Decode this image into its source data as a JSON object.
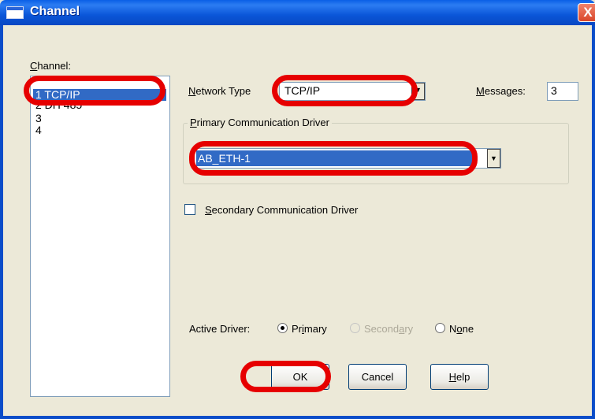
{
  "window": {
    "title": "Channel",
    "close_label": "X"
  },
  "channel_list": {
    "label_prefix": "C",
    "label_rest": "hannel:",
    "items": [
      {
        "label": "1  TCP/IP",
        "selected": true
      },
      {
        "label": "2  DH 485",
        "selected": false
      },
      {
        "label": "3",
        "selected": false
      },
      {
        "label": "4",
        "selected": false
      }
    ]
  },
  "network_type": {
    "label_prefix": "N",
    "label_rest": "etwork Type",
    "value": "TCP/IP"
  },
  "messages": {
    "label_prefix": "M",
    "label_rest": "essages:",
    "value": "3"
  },
  "primary_driver": {
    "group_label_prefix": "P",
    "group_label_rest": "rimary Communication Driver",
    "value": "AB_ETH-1"
  },
  "secondary_driver": {
    "label_prefix": "S",
    "label_rest": "econdary Communication Driver",
    "checked": false
  },
  "active_driver": {
    "label": "Active Driver:",
    "primary_prefix": "Pr",
    "primary_u": "i",
    "primary_rest": "mary",
    "secondary_prefix": "Second",
    "secondary_u": "a",
    "secondary_rest": "ry",
    "none_prefix": "N",
    "none_u": "o",
    "none_rest": "ne",
    "selected": "Primary"
  },
  "buttons": {
    "ok": "OK",
    "cancel": "Cancel",
    "help_u": "H",
    "help_rest": "elp"
  },
  "colors": {
    "highlight": "#E60000",
    "selection": "#316AC5",
    "titlebar": "#0A5FE6"
  }
}
